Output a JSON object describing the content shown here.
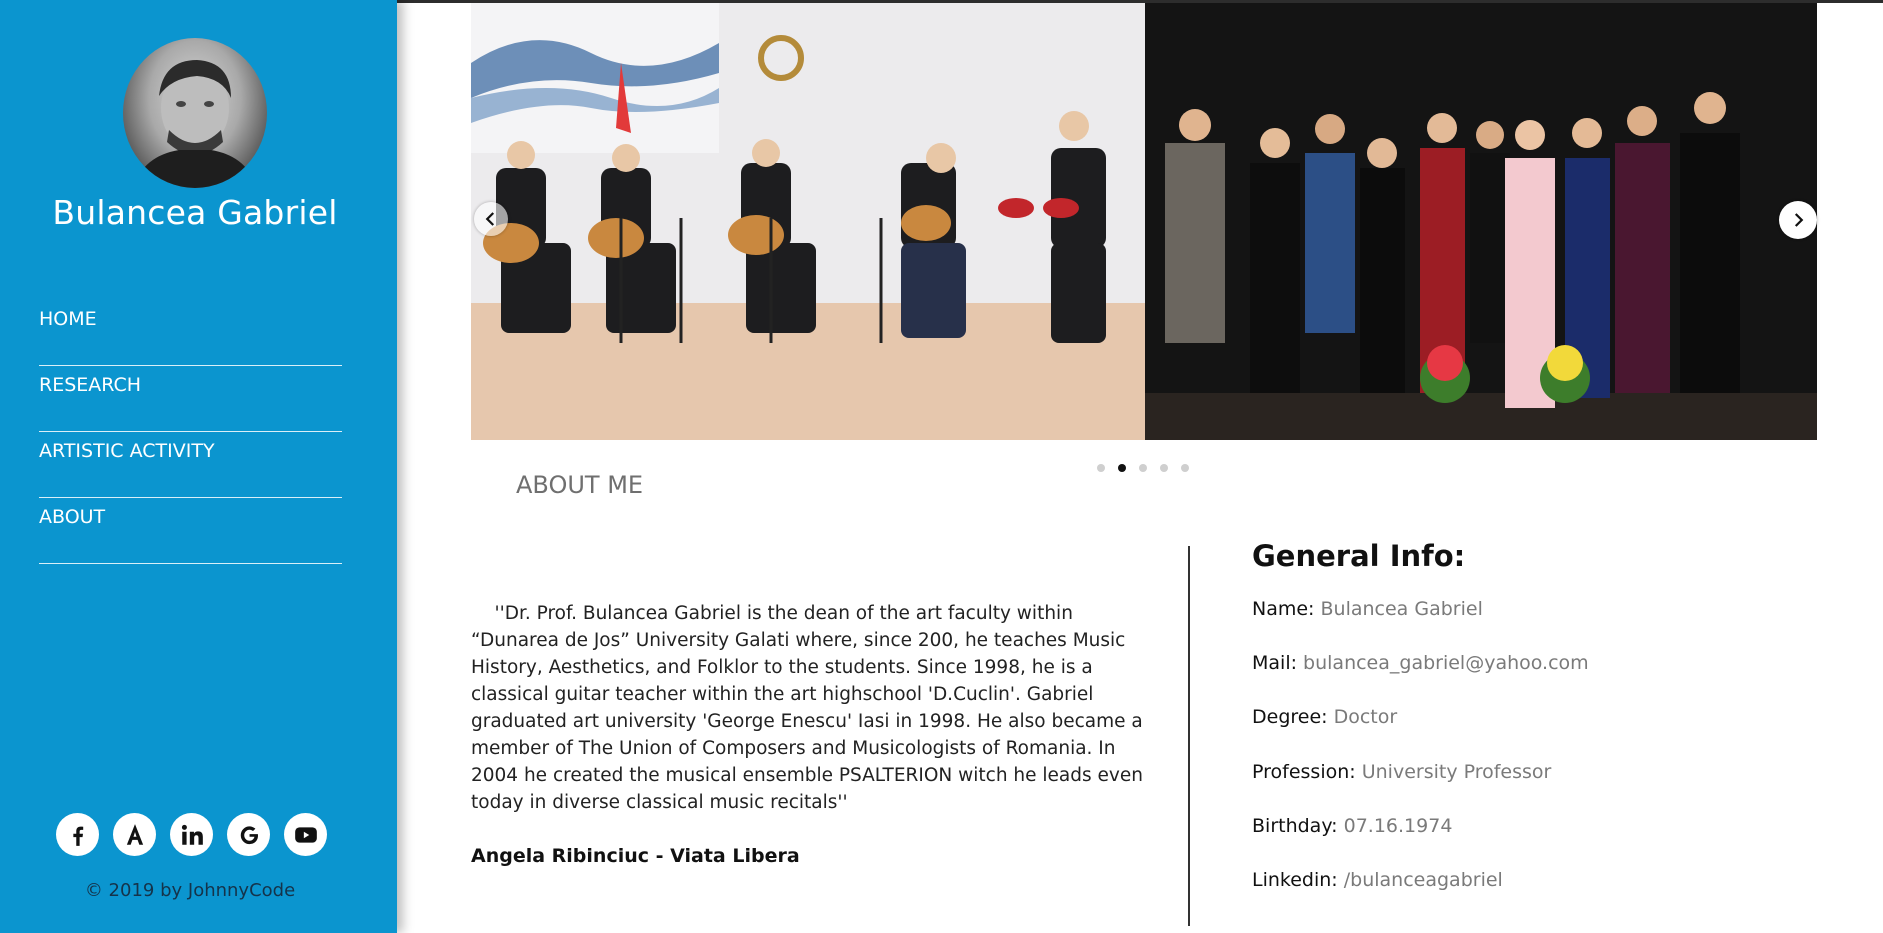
{
  "sidebar": {
    "name": "Bulancea Gabriel",
    "nav": [
      {
        "label": "HOME"
      },
      {
        "label": "RESEARCH"
      },
      {
        "label": "ARTISTIC ACTIVITY"
      },
      {
        "label": "ABOUT"
      }
    ],
    "social": [
      "facebook-icon",
      "academia-icon",
      "linkedin-icon",
      "google-plus-icon",
      "youtube-icon"
    ],
    "copyright": "© 2019 by JohnnyCode"
  },
  "carousel": {
    "slide_count": 5,
    "active_index": 1
  },
  "section": {
    "title": "ABOUT ME"
  },
  "quote": {
    "text": "    ''Dr. Prof. Bulancea Gabriel is the dean of the art faculty within “Dunarea de Jos” University Galati where, since 200, he teaches Music History, Aesthetics, and Folklor to the students. Since 1998, he is a classical guitar teacher within the art highschool 'D.Cuclin'. Gabriel graduated art university 'George Enescu' Iasi in 1998. He also became a member of The Union of Composers and Musicologists of Romania. In 2004 he created the musical ensemble PSALTERION witch he leads even today in diverse classical music recitals''",
    "author": "Angela Ribinciuc - Viata Libera"
  },
  "info": {
    "title": "General Info:",
    "rows": [
      {
        "label": "Name: ",
        "value": "Bulancea Gabriel"
      },
      {
        "label": "Mail: ",
        "value": "bulancea_gabriel@yahoo.com"
      },
      {
        "label": "Degree: ",
        "value": "Doctor"
      },
      {
        "label": "Profession: ",
        "value": "University Professor"
      },
      {
        "label": "Birthday: ",
        "value": "07.16.1974"
      },
      {
        "label": "Linkedin: ",
        "value": "/bulanceagabriel"
      }
    ]
  },
  "colors": {
    "sidebar": "#0b95cf",
    "muted_text": "#7a7a7a"
  }
}
